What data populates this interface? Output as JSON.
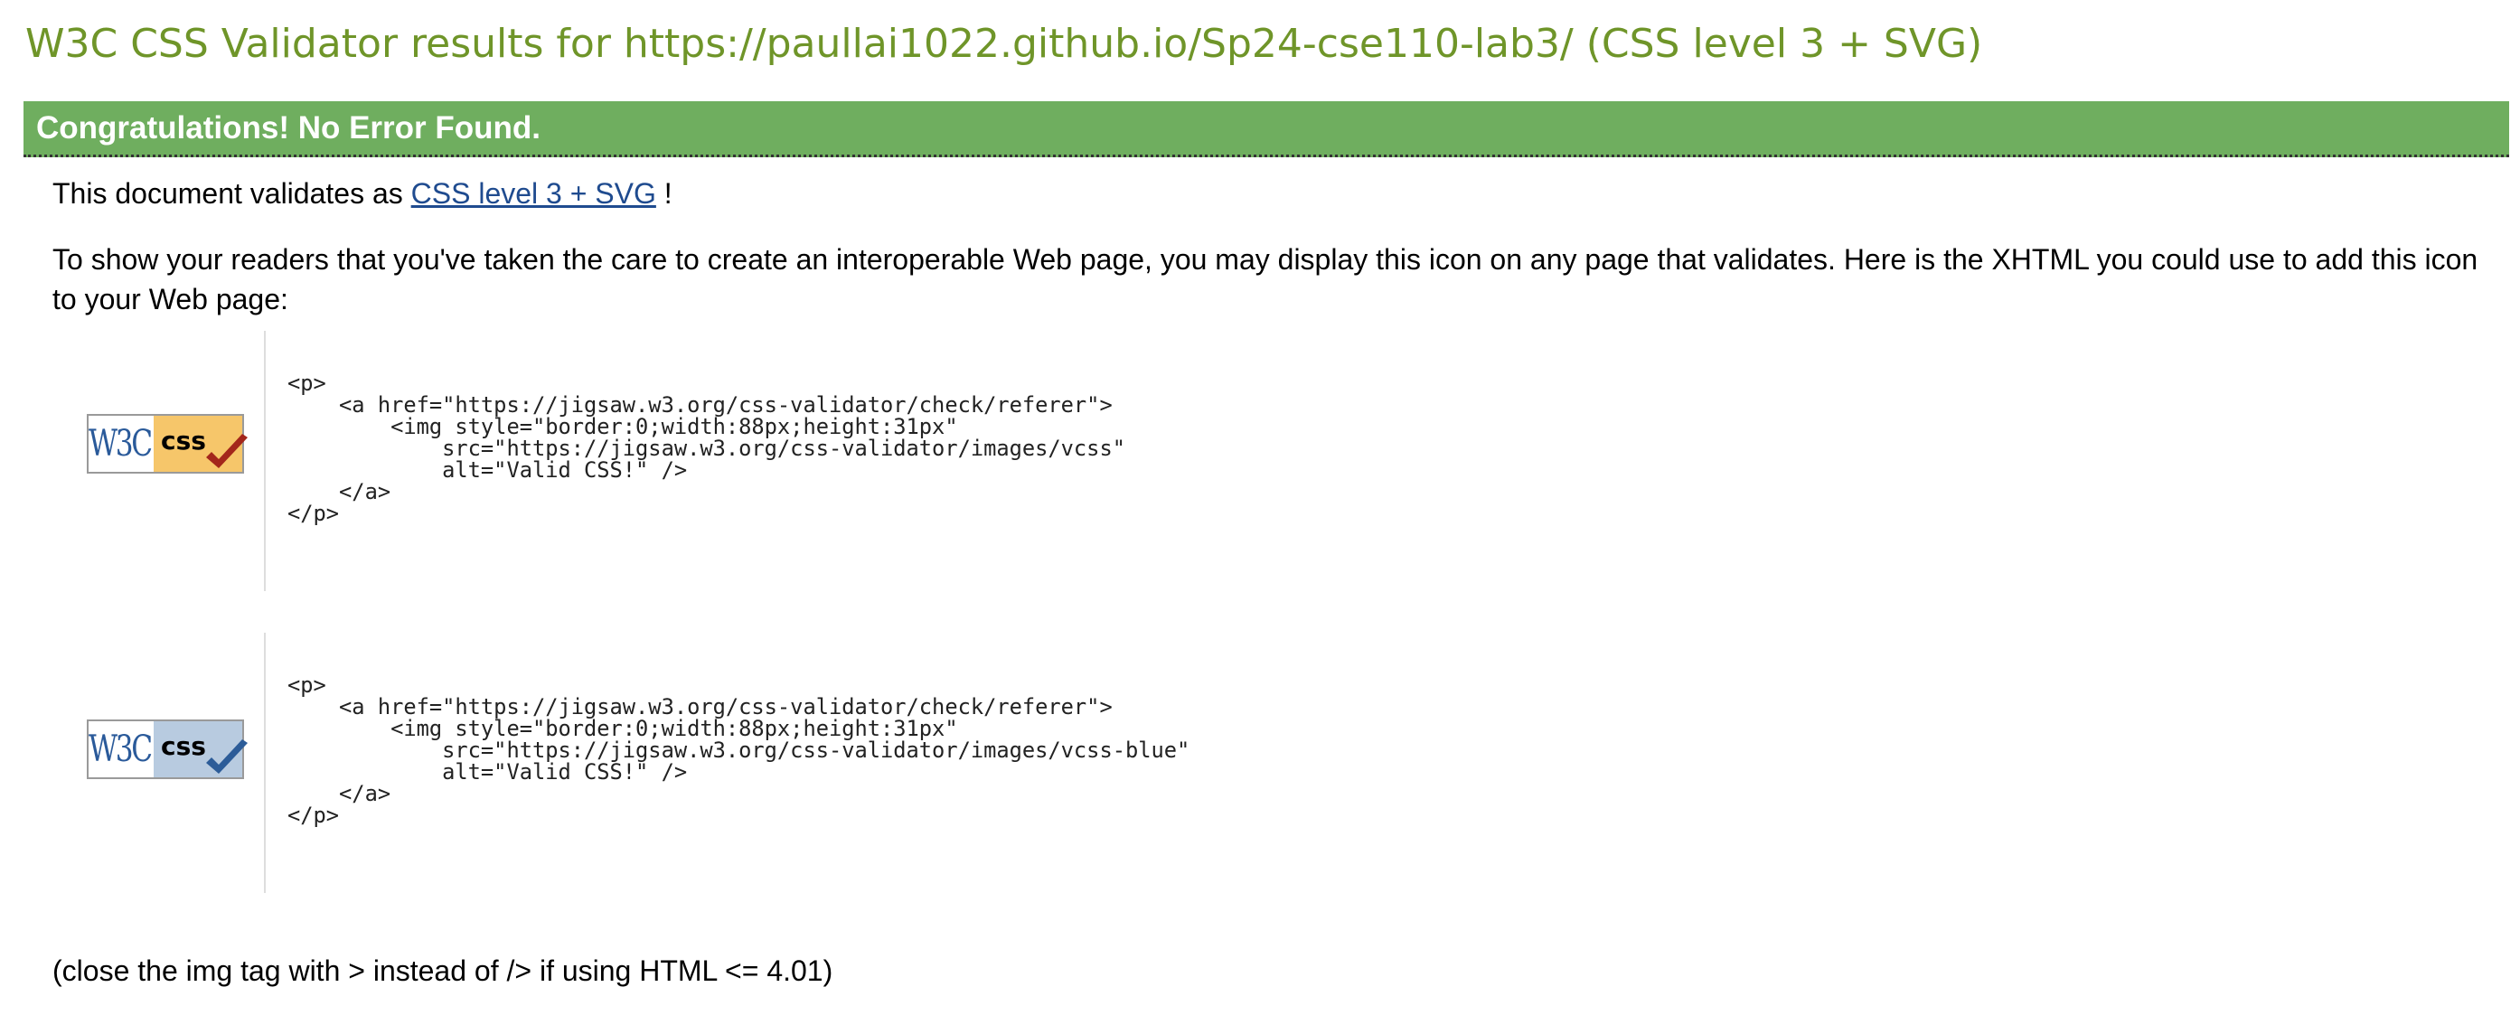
{
  "page": {
    "title": "W3C CSS Validator results for https://paullai1022.github.io/Sp24-cse110-lab3/ (CSS level 3 + SVG)"
  },
  "banner": {
    "text": "Congratulations! No Error Found."
  },
  "validates": {
    "prefix": "This document validates as ",
    "link_text": "CSS level 3 + SVG",
    "suffix": " !"
  },
  "readers_text": "To show your readers that you've taken the care to create an interoperable Web page, you may display this icon on any page that validates. Here is the XHTML you could use to add this icon to your Web page:",
  "badges": [
    {
      "w3c_text": "W3C",
      "css_text": "css",
      "icon": "valid-css-gold-badge-icon",
      "color": "#f6c66a",
      "check_color": "#a3261b",
      "code": "<p>\n    <a href=\"https://jigsaw.w3.org/css-validator/check/referer\">\n        <img style=\"border:0;width:88px;height:31px\"\n            src=\"https://jigsaw.w3.org/css-validator/images/vcss\"\n            alt=\"Valid CSS!\" />\n    </a>\n</p>"
    },
    {
      "w3c_text": "W3C",
      "css_text": "css",
      "icon": "valid-css-blue-badge-icon",
      "color": "#b8cbe0",
      "check_color": "#2c5c98",
      "code": "<p>\n    <a href=\"https://jigsaw.w3.org/css-validator/check/referer\">\n        <img style=\"border:0;width:88px;height:31px\"\n            src=\"https://jigsaw.w3.org/css-validator/images/vcss-blue\"\n            alt=\"Valid CSS!\" />\n    </a>\n</p>"
    }
  ],
  "closing_text": "(close the img tag with > instead of /> if using HTML <= 4.01)",
  "colors": {
    "title": "#6f9529",
    "banner": "#6fae5f",
    "link": "#1f4b8f"
  }
}
